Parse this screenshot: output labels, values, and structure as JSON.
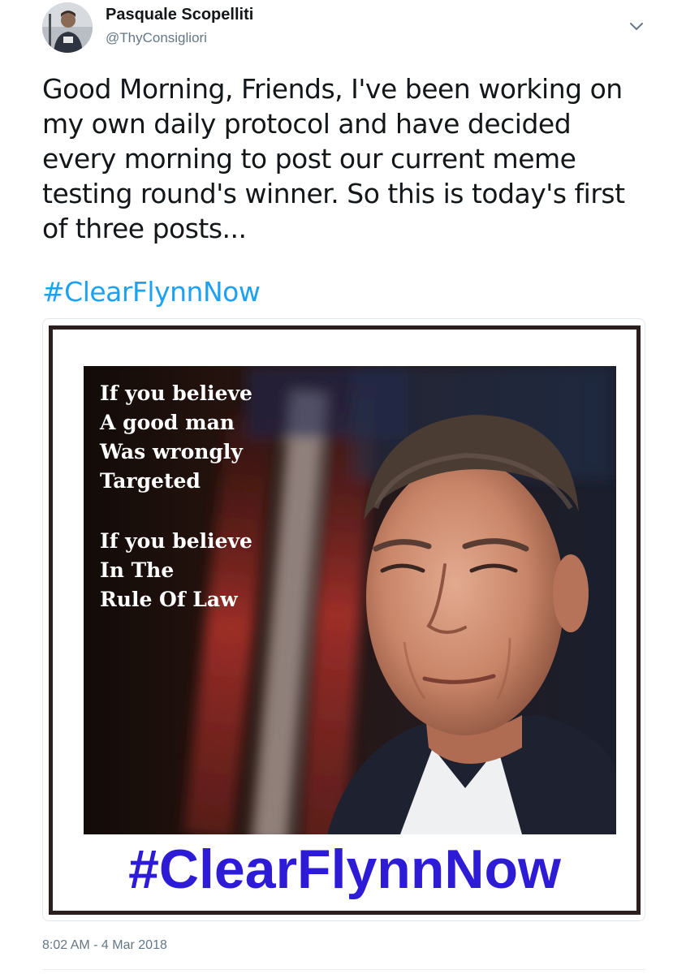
{
  "author": {
    "display_name": "Pasquale Scopelliti",
    "handle": "@ThyConsigliori",
    "avatar_icon": "profile-photo-avatar"
  },
  "menu": {
    "caret_icon": "chevron-down-icon"
  },
  "tweet": {
    "text": "Good Morning, Friends, I've been working on\nmy own daily protocol and have decided\nevery morning to post our current meme\ntesting round's winner.  So this is today's first\nof three posts...",
    "hashtag": "#ClearFlynnNow",
    "timestamp": "8:02 AM - 4 Mar 2018"
  },
  "media": {
    "meme_lines_1": "If you believe\nA good man\nWas wrongly\nTargeted",
    "meme_lines_2": "If you believe\nIn The\nRule Of Law",
    "meme_hashtag": "#ClearFlynnNow",
    "hashtag_color": "#2d1bd6"
  },
  "colors": {
    "link": "#1da1f2",
    "text": "#14171a",
    "muted": "#657786"
  }
}
